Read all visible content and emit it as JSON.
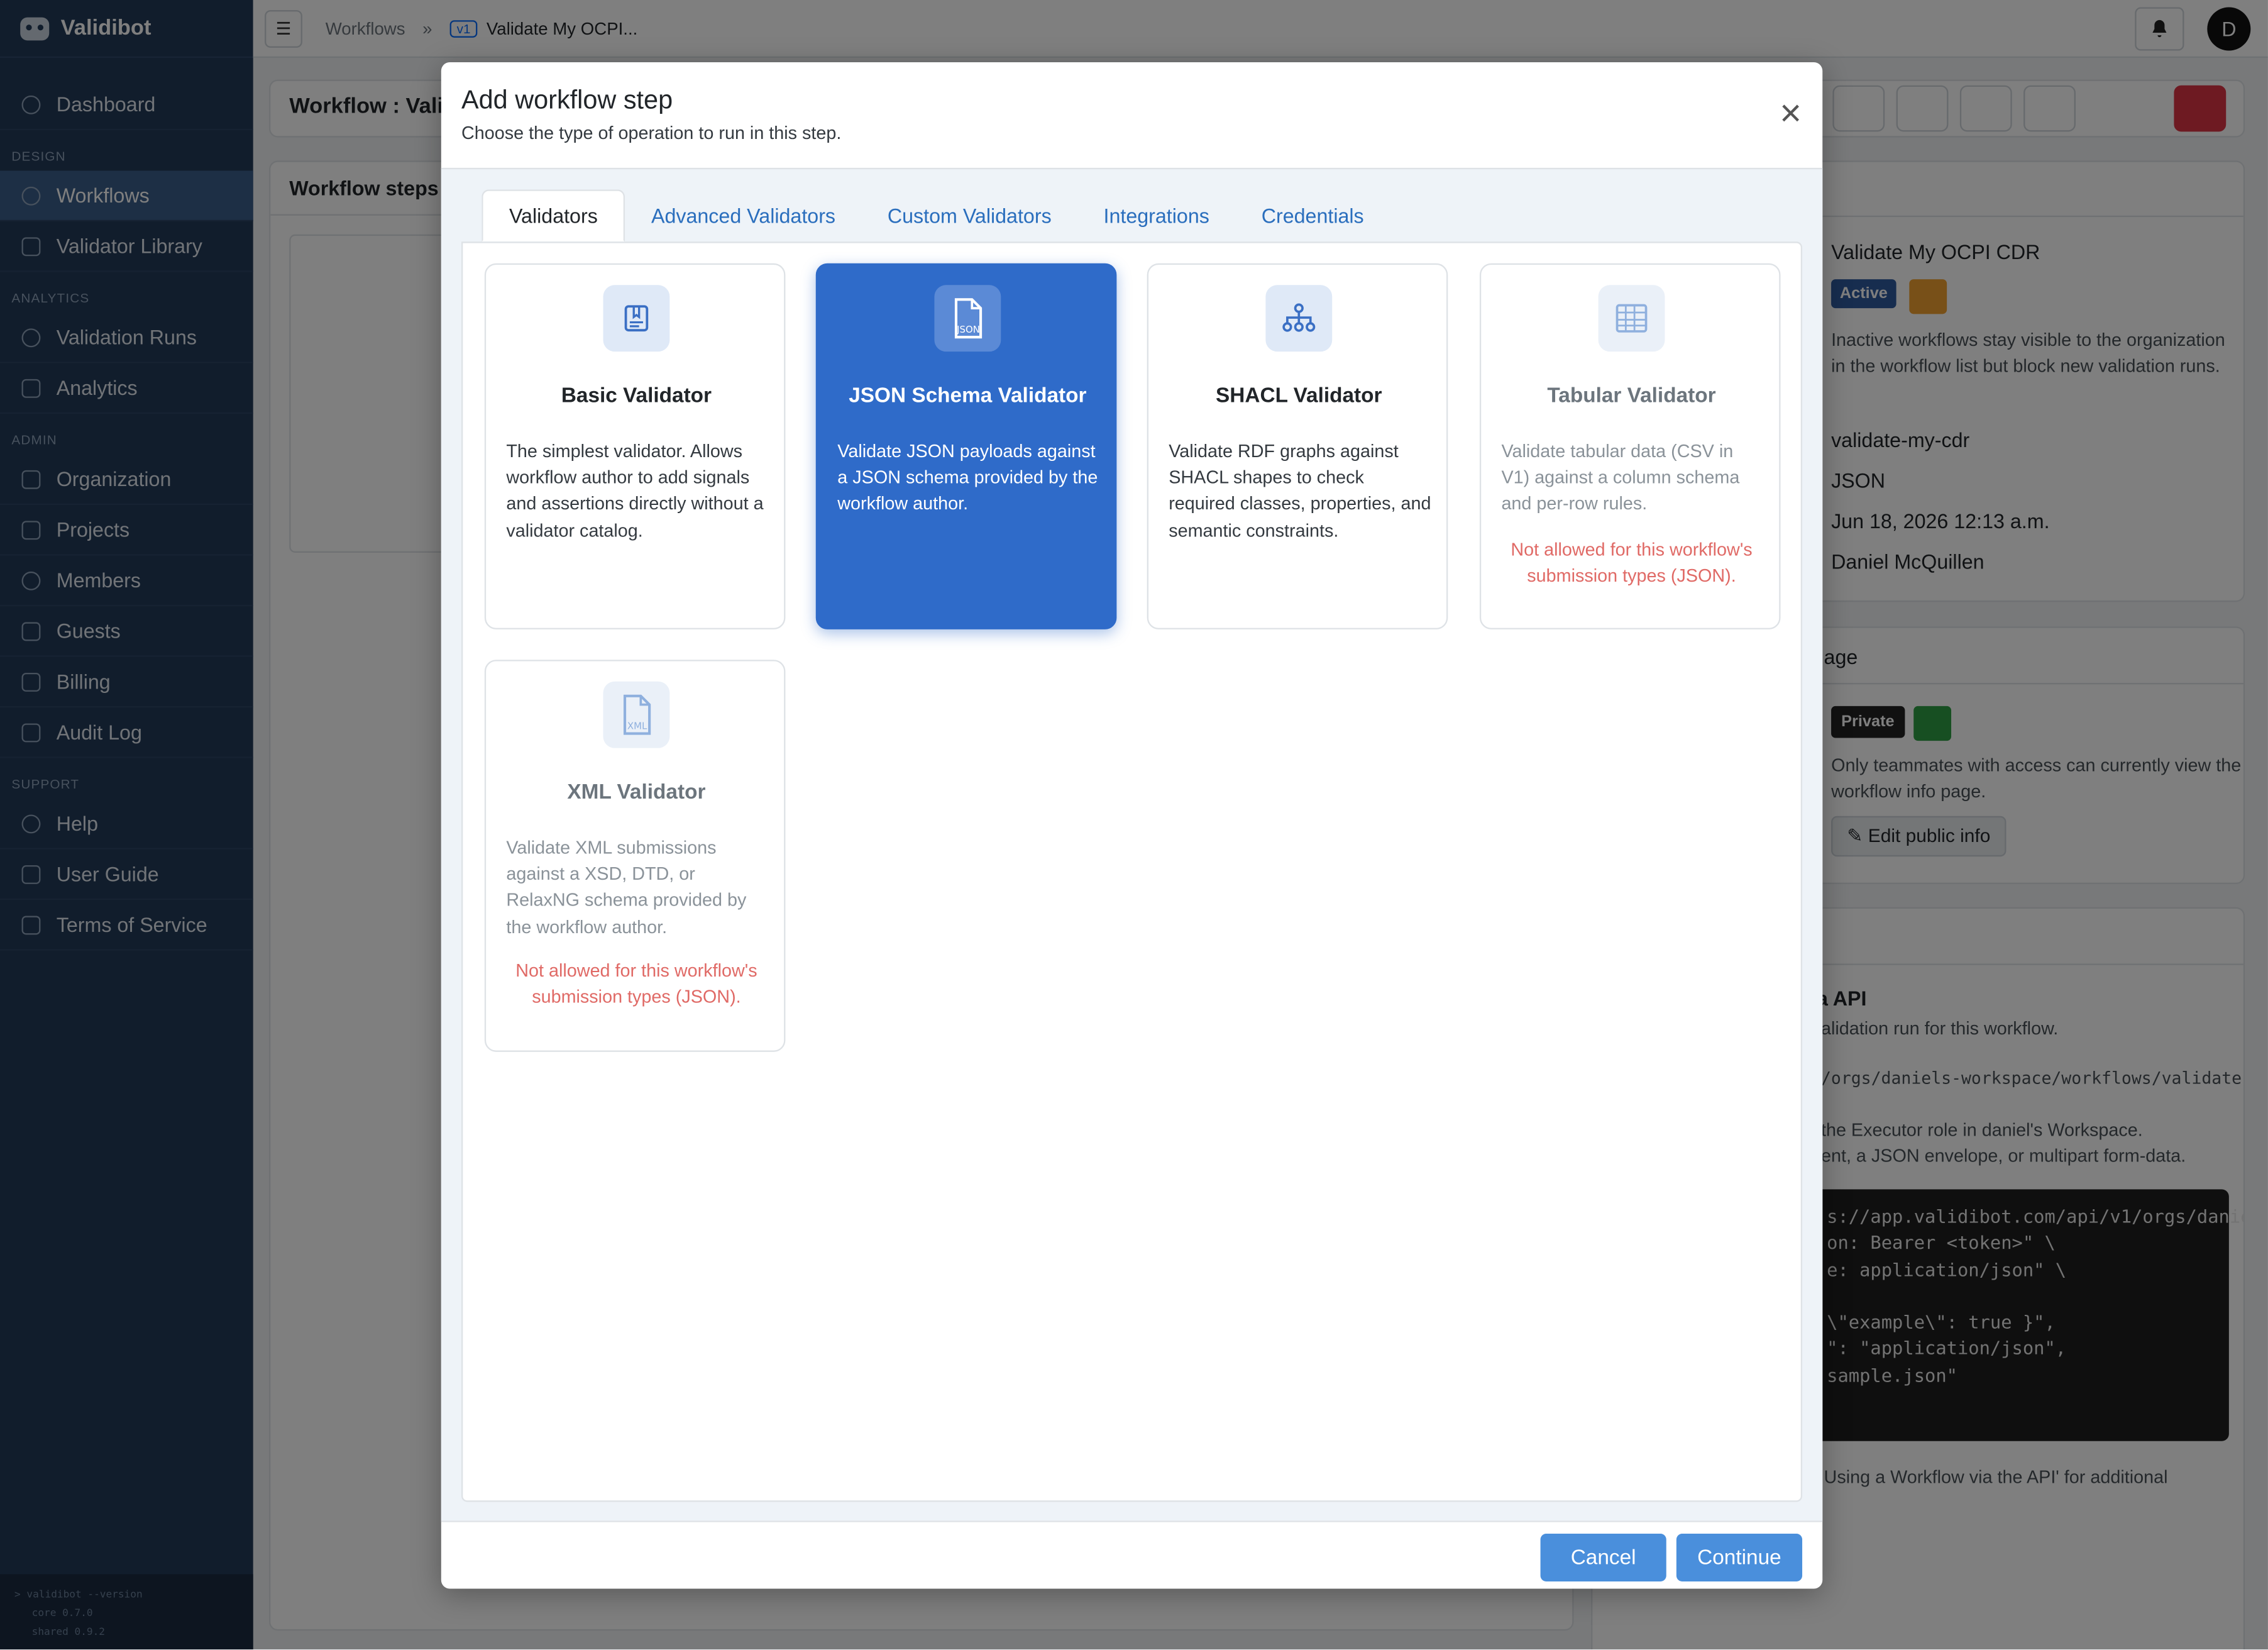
{
  "app": {
    "name": "Validibot"
  },
  "sidebar": {
    "sections": {
      "design": "DESIGN",
      "analytics": "ANALYTICS",
      "admin": "ADMIN",
      "support": "SUPPORT"
    },
    "items": {
      "dashboard": "Dashboard",
      "workflows": "Workflows",
      "validator_library": "Validator Library",
      "validation_runs": "Validation Runs",
      "analytics": "Analytics",
      "organization": "Organization",
      "projects": "Projects",
      "members": "Members",
      "guests": "Guests",
      "billing": "Billing",
      "audit_log": "Audit Log",
      "help": "Help",
      "user_guide": "User Guide",
      "terms": "Terms of Service"
    },
    "terminal": [
      "> validibot --version",
      "core 0.7.0",
      "shared 0.9.2"
    ]
  },
  "topbar": {
    "crumb_workflows": "Workflows",
    "crumb_sep": "»",
    "version_badge": "v1",
    "crumb_current": "Validate My OCPI...",
    "avatar_initial": "D"
  },
  "page": {
    "title": "Workflow : Valid",
    "steps_title": "Workflow steps"
  },
  "info_card": {
    "name": "Validate My OCPI CDR",
    "status": "Active",
    "inactive_note": "Inactive workflows stay visible to the organization in the workflow list but block new validation runs.",
    "slug": "validate-my-cdr",
    "type": "JSON",
    "date": "Jun 18, 2026 12:13 a.m.",
    "owner": "Daniel McQuillen"
  },
  "public_card": {
    "title": "age",
    "visibility": "Private",
    "note": "Only teammates with access can currently view the workflow info page.",
    "edit_label": "Edit public info"
  },
  "api_card": {
    "title": "a API",
    "line1": "alidation run for this workflow.",
    "path": "/orgs/daniels-workspace/workflows/validate-",
    "line2": "the Executor role in daniel's Workspace.",
    "line3": "ent, a JSON envelope, or multipart form-data.",
    "code": [
      "s://app.validibot.com/api/v1/orgs/danie",
      "on: Bearer <token>\" \\",
      "e: application/json\" \\",
      "",
      " \\\"example\\\": true }\",",
      "\": \"application/json\",",
      "sample.json\""
    ],
    "footer": "Using a Workflow via the API' for additional"
  },
  "modal": {
    "title": "Add workflow step",
    "subtitle": "Choose the type of operation to run in this step.",
    "tabs": [
      "Validators",
      "Advanced Validators",
      "Custom Validators",
      "Integrations",
      "Credentials"
    ],
    "validators": [
      {
        "name": "Basic Validator",
        "icon": "book-icon",
        "description": "The simplest validator. Allows workflow author to add signals and assertions directly without a validator catalog.",
        "warning": ""
      },
      {
        "name": "JSON Schema Validator",
        "icon": "json-file-icon",
        "icon_label": "JSON",
        "description": "Validate JSON payloads against a JSON schema provided by the workflow author.",
        "warning": ""
      },
      {
        "name": "SHACL Validator",
        "icon": "hierarchy-icon",
        "description": "Validate RDF graphs against SHACL shapes to check required classes, properties, and semantic constraints.",
        "warning": ""
      },
      {
        "name": "Tabular Validator",
        "icon": "table-icon",
        "description": "Validate tabular data (CSV in V1) against a column schema and per-row rules.",
        "warning": "Not allowed for this workflow's submission types (JSON)."
      },
      {
        "name": "XML Validator",
        "icon": "xml-file-icon",
        "icon_label": "XML",
        "description": "Validate XML submissions against a XSD, DTD, or RelaxNG schema provided by the workflow author.",
        "warning": "Not allowed for this workflow's submission types (JSON)."
      }
    ],
    "cancel_label": "Cancel",
    "continue_label": "Continue"
  },
  "colors": {
    "sidebar_bg": "#233a58",
    "accent": "#2f6bc9",
    "button": "#4a8fdc",
    "warning_text": "#e06a66",
    "danger": "#dc3545"
  }
}
